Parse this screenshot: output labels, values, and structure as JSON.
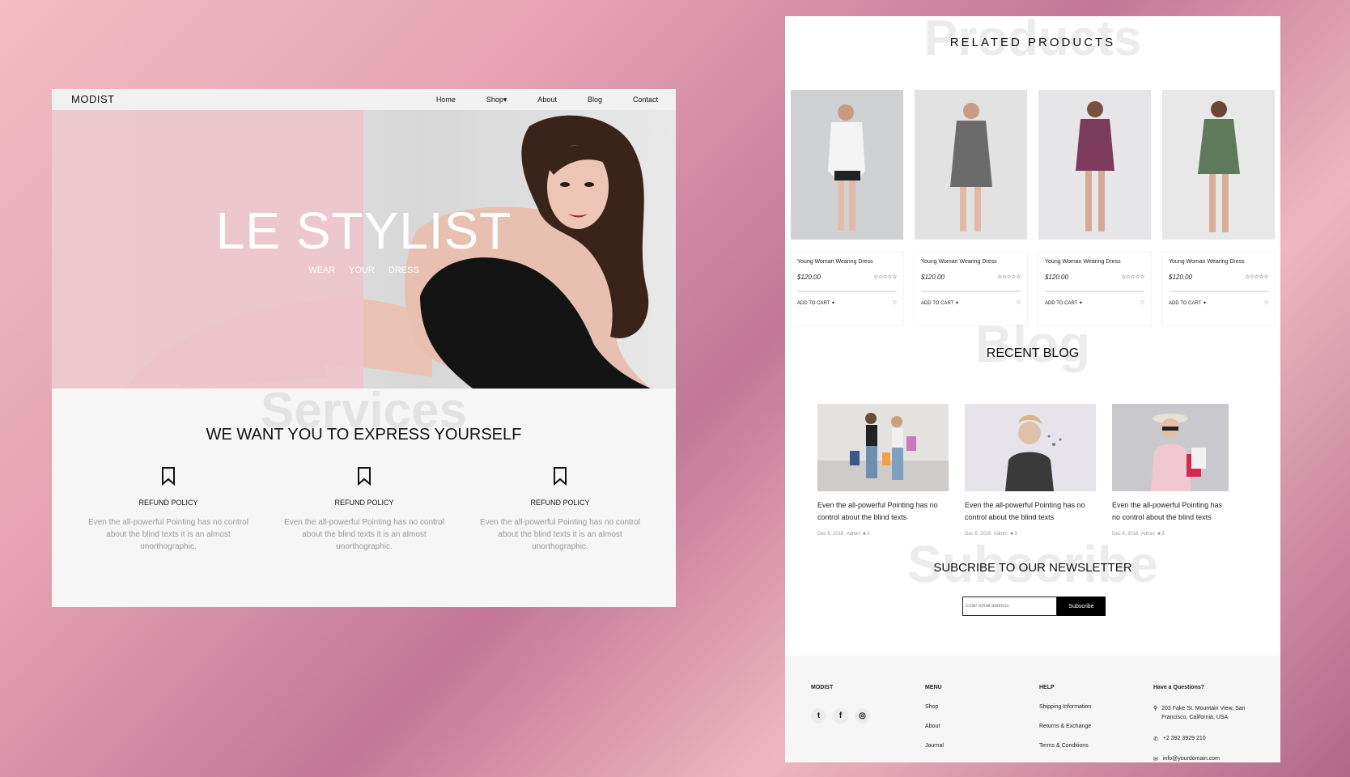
{
  "left": {
    "logo": "MODIST",
    "nav": [
      "Home",
      "Shop▾",
      "About",
      "Blog",
      "Contact"
    ],
    "hero_title": "LE STYLIST",
    "hero_subtitle": "WEAR YOUR DRESS",
    "services_ghost": "Services",
    "services_title": "WE WANT YOU TO EXPRESS YOURSELF",
    "services": [
      {
        "title": "REFUND POLICY",
        "text": "Even the all-powerful Pointing has no control about the blind texts it is an almost unorthographic.",
        "icon": "bookmark-icon"
      },
      {
        "title": "REFUND POLICY",
        "text": "Even the all-powerful Pointing has no control about the blind texts it is an almost unorthographic.",
        "icon": "bookmark-icon"
      },
      {
        "title": "REFUND POLICY",
        "text": "Even the all-powerful Pointing has no control about the blind texts it is an almost unorthographic.",
        "icon": "bookmark-icon"
      }
    ]
  },
  "right": {
    "products_ghost": "Products",
    "products_title": "RELATED PRODUCTS",
    "products": [
      {
        "name": "Young Woman Wearing Dress",
        "price": "$120.00",
        "stars": "☆☆☆☆☆",
        "cart": "ADD TO CART ✦"
      },
      {
        "name": "Young Woman Wearing Dress",
        "price": "$120.00",
        "stars": "☆☆☆☆☆",
        "cart": "ADD TO CART ✦"
      },
      {
        "name": "Young Woman Wearing Dress",
        "price": "$120.00",
        "stars": "☆☆☆☆☆",
        "cart": "ADD TO CART ✦"
      },
      {
        "name": "Young Woman Wearing Dress",
        "price": "$120.00",
        "stars": "☆☆☆☆☆",
        "cart": "ADD TO CART ✦"
      }
    ],
    "blog_ghost": "Blog",
    "blog_title": "RECENT BLOG",
    "blog": [
      {
        "title": "Even the all-powerful Pointing has no control about the blind texts",
        "date": "Dec 6, 2018",
        "author": "Admin",
        "comments": "3"
      },
      {
        "title": "Even the all-powerful Pointing has no control about the blind texts",
        "date": "Dec 6, 2018",
        "author": "Admin",
        "comments": "3"
      },
      {
        "title": "Even the all-powerful Pointing has no control about the blind texts",
        "date": "Dec 6, 2018",
        "author": "Admin",
        "comments": "3"
      }
    ],
    "subscribe_ghost": "Subscribe",
    "subscribe_title": "SUBCRIBE TO OUR NEWSLETTER",
    "subscribe_placeholder": "Enter email address",
    "subscribe_button": "Subscribe",
    "footer": {
      "brand": "MODIST",
      "menu_title": "MENU",
      "menu": [
        "Shop",
        "About",
        "Journal"
      ],
      "help_title": "HELP",
      "help": [
        "Shipping Information",
        "Returns & Exchange",
        "Terms & Conditions"
      ],
      "contact_title": "Have a Questions?",
      "address": "203 Fake St. Mountain View, San Francisco, California, USA",
      "phone": "+2 392 3929 210",
      "email": "info@yourdomain.com"
    }
  }
}
